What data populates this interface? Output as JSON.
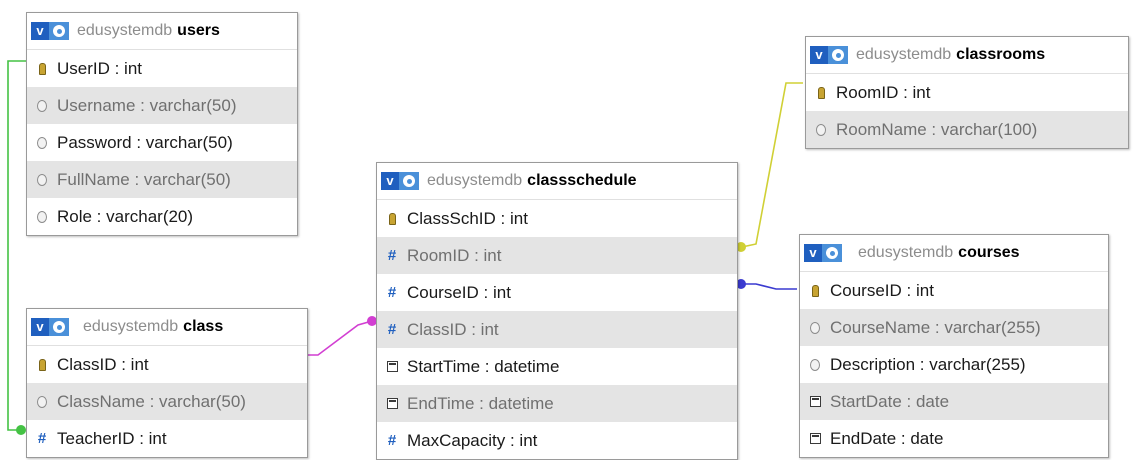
{
  "tables": {
    "users": {
      "db": "edusystemdb",
      "name": "users",
      "columns": [
        {
          "text": "UserID : int",
          "icon": "primary-key-icon"
        },
        {
          "text": "Username : varchar(50)",
          "icon": "text-column-icon"
        },
        {
          "text": "Password : varchar(50)",
          "icon": "text-column-icon"
        },
        {
          "text": "FullName : varchar(50)",
          "icon": "text-column-icon"
        },
        {
          "text": "Role : varchar(20)",
          "icon": "text-column-icon"
        }
      ]
    },
    "class": {
      "db": "edusystemdb",
      "name": "class",
      "columns": [
        {
          "text": "ClassID : int",
          "icon": "primary-key-icon"
        },
        {
          "text": "ClassName : varchar(50)",
          "icon": "text-column-icon"
        },
        {
          "text": "TeacherID : int",
          "icon": "numeric-column-icon"
        }
      ]
    },
    "classschedule": {
      "db": "edusystemdb",
      "name": "classschedule",
      "columns": [
        {
          "text": "ClassSchID : int",
          "icon": "primary-key-icon"
        },
        {
          "text": "RoomID : int",
          "icon": "numeric-column-icon"
        },
        {
          "text": "CourseID : int",
          "icon": "numeric-column-icon"
        },
        {
          "text": "ClassID : int",
          "icon": "numeric-column-icon"
        },
        {
          "text": "StartTime : datetime",
          "icon": "date-column-icon"
        },
        {
          "text": "EndTime : datetime",
          "icon": "date-column-icon"
        },
        {
          "text": "MaxCapacity : int",
          "icon": "numeric-column-icon"
        }
      ]
    },
    "classrooms": {
      "db": "edusystemdb",
      "name": "classrooms",
      "columns": [
        {
          "text": "RoomID : int",
          "icon": "primary-key-icon"
        },
        {
          "text": "RoomName : varchar(100)",
          "icon": "text-column-icon"
        }
      ]
    },
    "courses": {
      "db": "edusystemdb",
      "name": "courses",
      "columns": [
        {
          "text": "CourseID : int",
          "icon": "primary-key-icon"
        },
        {
          "text": "CourseName : varchar(255)",
          "icon": "text-column-icon"
        },
        {
          "text": "Description : varchar(255)",
          "icon": "text-column-icon"
        },
        {
          "text": "StartDate : date",
          "icon": "date-column-icon"
        },
        {
          "text": "EndDate : date",
          "icon": "date-column-icon"
        }
      ]
    }
  },
  "header_buttons": {
    "toggle_label": "v",
    "options_icon": "gear-icon"
  },
  "relations": [
    {
      "from": "class.TeacherID",
      "to": "users.UserID",
      "color": "#44c244"
    },
    {
      "from": "classschedule.ClassID",
      "to": "class.ClassID",
      "color": "#d23fd2"
    },
    {
      "from": "classschedule.RoomID",
      "to": "classrooms.RoomID",
      "color": "#d0d035"
    },
    {
      "from": "classschedule.CourseID",
      "to": "courses.CourseID",
      "color": "#3a3ad0"
    }
  ]
}
